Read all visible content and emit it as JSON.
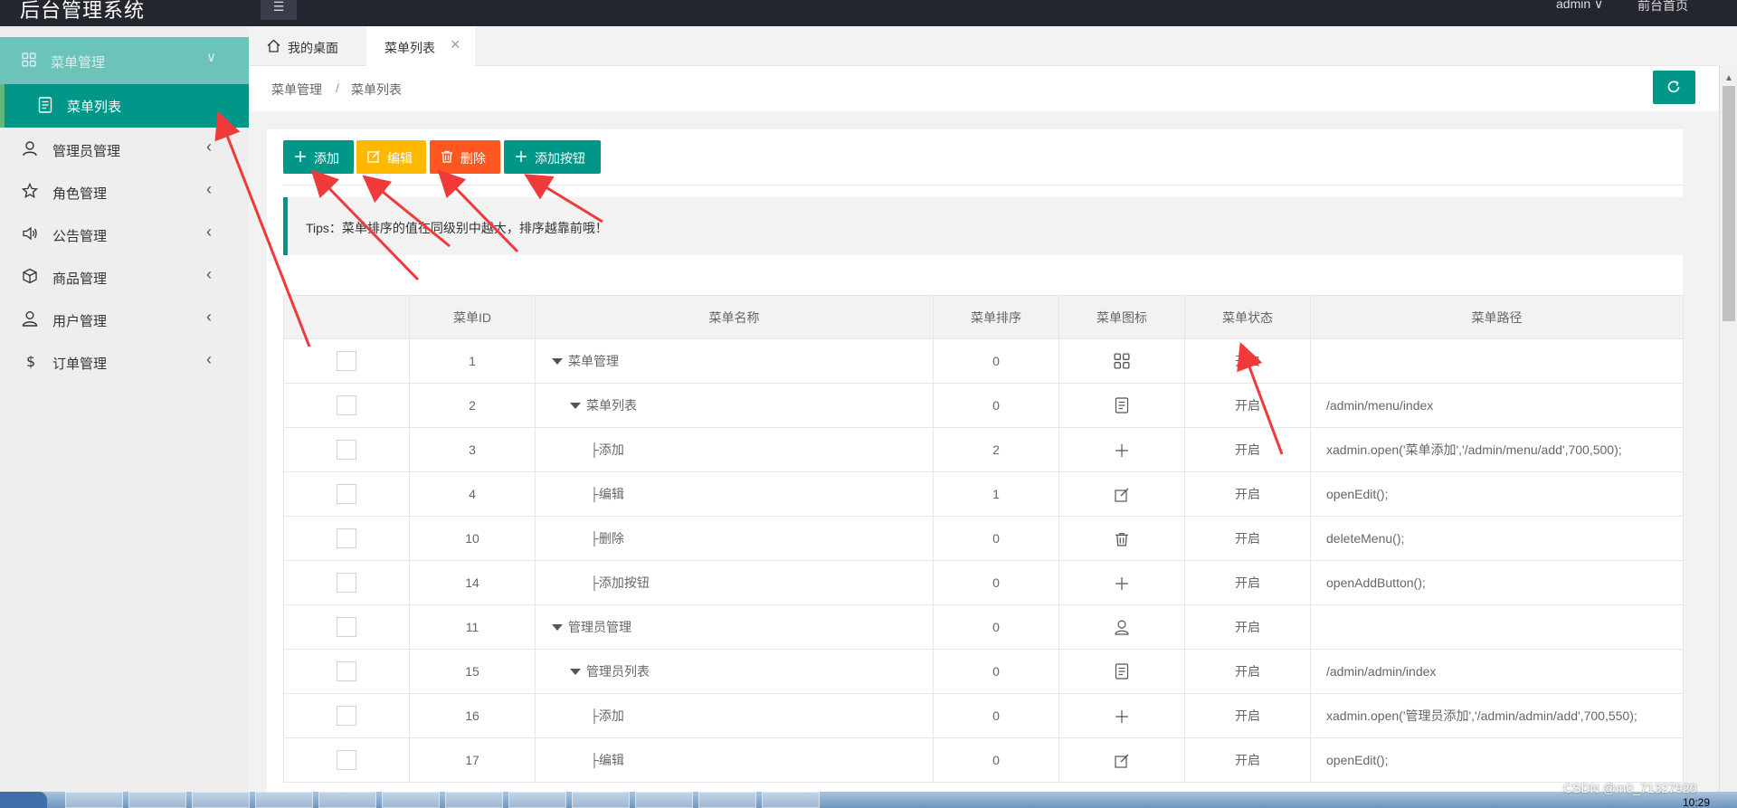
{
  "header": {
    "logo": "后台管理系统",
    "toggle_icon": "menu-icon",
    "admin_label": "admin ∨",
    "front_link": "前台首页"
  },
  "sidebar": {
    "parent": {
      "label": "菜单管理",
      "icon": "grid-icon"
    },
    "active": {
      "label": "菜单列表",
      "icon": "document-icon"
    },
    "items": [
      {
        "label": "管理员管理",
        "icon": "user-icon"
      },
      {
        "label": "角色管理",
        "icon": "star-icon"
      },
      {
        "label": "公告管理",
        "icon": "speaker-icon"
      },
      {
        "label": "商品管理",
        "icon": "box-icon"
      },
      {
        "label": "用户管理",
        "icon": "person-icon"
      },
      {
        "label": "订单管理",
        "icon": "dollar-icon"
      }
    ]
  },
  "tabs": [
    {
      "label": "我的桌面"
    },
    {
      "label": "菜单列表"
    }
  ],
  "breadcrumb": {
    "level1": "菜单管理",
    "separator": "/",
    "level2": "菜单列表"
  },
  "toolbar": {
    "add": "添加",
    "edit": "编辑",
    "delete": "删除",
    "add_button": "添加按钮"
  },
  "tips": "Tips：菜单排序的值在同级别中越大，排序越靠前哦！",
  "table": {
    "headers": [
      "",
      "菜单ID",
      "菜单名称",
      "菜单排序",
      "菜单图标",
      "菜单状态",
      "菜单路径"
    ],
    "rows": [
      {
        "id": "1",
        "name": "菜单管理",
        "sort": "0",
        "icon": "grid-icon",
        "status": "开启",
        "path": ""
      },
      {
        "id": "2",
        "name": "菜单列表",
        "sort": "0",
        "icon": "document-icon",
        "status": "开启",
        "path": "/admin/menu/index"
      },
      {
        "id": "3",
        "name": "├添加",
        "sort": "2",
        "icon": "plus-icon",
        "status": "开启",
        "path": "xadmin.open('菜单添加','/admin/menu/add',700,500);"
      },
      {
        "id": "4",
        "name": "├编辑",
        "sort": "1",
        "icon": "edit-icon",
        "status": "开启",
        "path": "openEdit();"
      },
      {
        "id": "10",
        "name": "├删除",
        "sort": "0",
        "icon": "trash-icon",
        "status": "开启",
        "path": "deleteMenu();"
      },
      {
        "id": "14",
        "name": "├添加按钮",
        "sort": "0",
        "icon": "plus-icon",
        "status": "开启",
        "path": "openAddButton();"
      },
      {
        "id": "11",
        "name": "管理员管理",
        "sort": "0",
        "icon": "user-icon",
        "status": "开启",
        "path": ""
      },
      {
        "id": "15",
        "name": "管理员列表",
        "sort": "0",
        "icon": "document-icon",
        "status": "开启",
        "path": "/admin/admin/index"
      },
      {
        "id": "16",
        "name": "├添加",
        "sort": "0",
        "icon": "plus-icon",
        "status": "开启",
        "path": "xadmin.open('管理员添加','/admin/admin/add',700,550);"
      },
      {
        "id": "17",
        "name": "├编辑",
        "sort": "0",
        "icon": "edit-icon",
        "status": "开启",
        "path": "openEdit();"
      }
    ]
  },
  "taskbar": {
    "clock": "10:29"
  },
  "watermark": "CSDN @m0_71327920",
  "colors": {
    "primary": "#009688",
    "warm": "#ffb800",
    "danger": "#ff5722",
    "annotation": "#f03a3a"
  }
}
